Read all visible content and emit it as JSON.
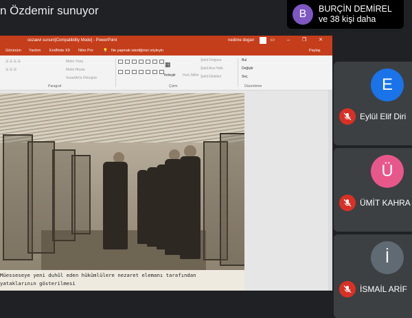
{
  "presenter": {
    "title": "n Özdemir sunuyor"
  },
  "join_notice": {
    "avatar_letter": "B",
    "name": "BURÇİN DEMİREL",
    "more": "ve 38 kişi daha"
  },
  "ppt": {
    "title": "cezaevi sunum[Compatibility Mode]  -  PowerPoint",
    "user": "nedime dogan",
    "menu": [
      "Görünüm",
      "Yardım",
      "EndNote X9",
      "Nitro Pro",
      "Ne yapmak istediğinizi söyleyin",
      "Paylaş"
    ],
    "ribbon": {
      "paragraph_items": [
        "Metin Yönü",
        "Metni Hizala",
        "SmartArt'a Dönüştür"
      ],
      "paragraph_label": "Paragraf",
      "arrange_label": "Yerleştir",
      "quick_styles_label": "Hızlı Stiller",
      "shape_items": [
        "Şekil Dolgusu",
        "Şekil Ana Hattı",
        "Şekil Efektleri"
      ],
      "drawing_label": "Çizim",
      "edit_items": [
        "Bul",
        "Değiştir",
        "Seç"
      ],
      "edit_label": "Düzenleme"
    },
    "caption_line1": "Müesseseye yeni duhûl eden hükümlülere nezaret elemanı tarafından",
    "caption_line2": "yataklarının gösterilmesi"
  },
  "participants": [
    {
      "letter": "E",
      "name": "Eylül Elif Diri",
      "color": "#1a73e8"
    },
    {
      "letter": "Ü",
      "name": "ÜMİT KAHRA",
      "color": "#e8578a"
    },
    {
      "letter": "İ",
      "name": "İSMAİL ARİF",
      "color": "#5f6a73"
    }
  ]
}
